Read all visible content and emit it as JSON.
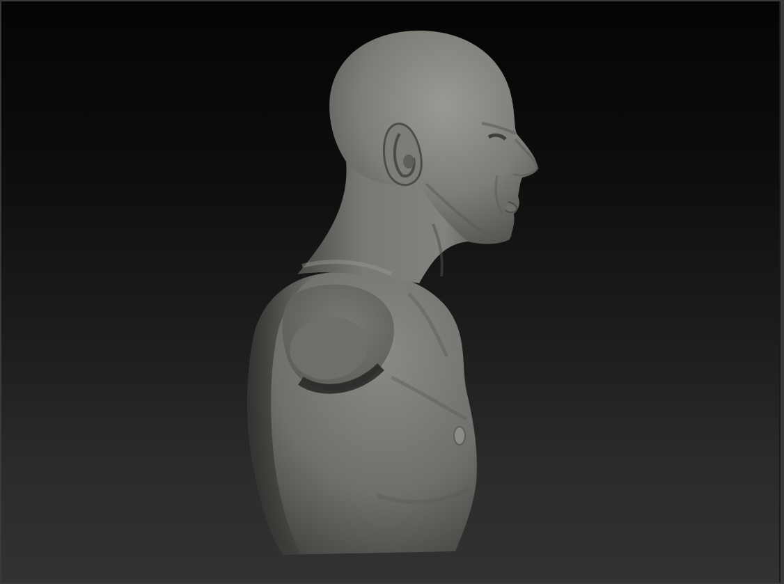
{
  "viewport": {
    "background_top_color": "#040404",
    "background_bottom_color": "#323232",
    "border_color": "#3a3a3a"
  },
  "model": {
    "subject": "bust-sculpt",
    "base_color": "#7c7c77",
    "shadow_color": "#3e3e3b",
    "highlight_color": "#9a9a95"
  }
}
